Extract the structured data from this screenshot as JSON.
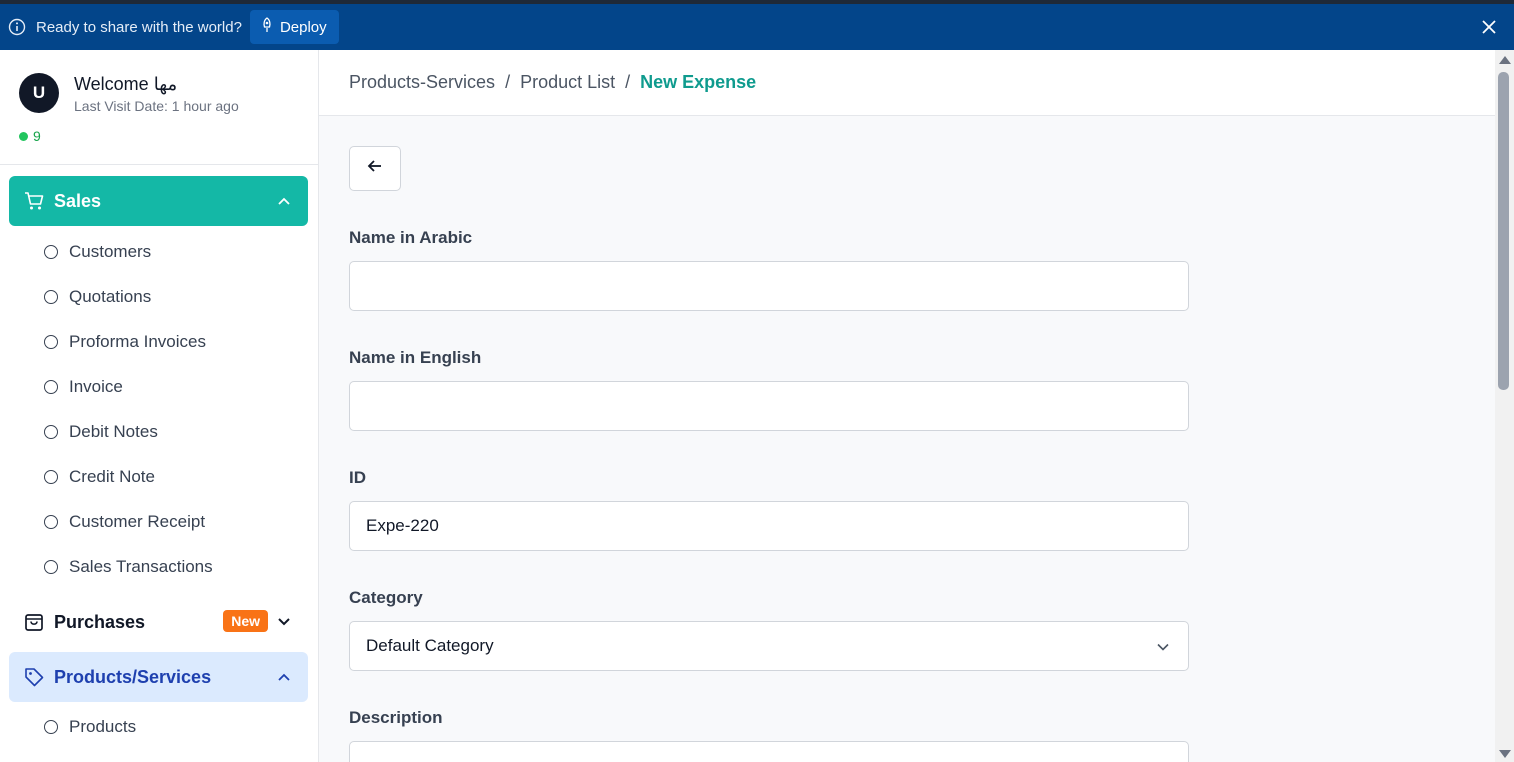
{
  "banner": {
    "message": "Ready to share with the world?",
    "deploy_label": "Deploy"
  },
  "user": {
    "avatar_initial": "U",
    "welcome": "Welcome مها",
    "last_visit": "Last Visit Date: 1 hour ago",
    "online_count": "9"
  },
  "sidebar": {
    "sales_label": "Sales",
    "sales_items": [
      "Customers",
      "Quotations",
      "Proforma Invoices",
      "Invoice",
      "Debit Notes",
      "Credit Note",
      "Customer Receipt",
      "Sales Transactions"
    ],
    "purchases_label": "Purchases",
    "purchases_badge": "New",
    "products_label": "Products/Services",
    "products_items": [
      "Products"
    ]
  },
  "breadcrumb": {
    "items": [
      "Products-Services",
      "Product List"
    ],
    "separator": "/",
    "current": "New Expense"
  },
  "form": {
    "name_ar_label": "Name in Arabic",
    "name_ar_value": "",
    "name_en_label": "Name in English",
    "name_en_value": "",
    "id_label": "ID",
    "id_value": "Expe-220",
    "category_label": "Category",
    "category_value": "Default Category",
    "description_label": "Description"
  },
  "colors": {
    "banner": "#03458a",
    "sales_active": "#14b8a6",
    "products_active": "#dbeafe",
    "badge_new": "#f97316",
    "breadcrumb_current": "#0f9b8e"
  },
  "icons": {
    "banner_info": "info-icon",
    "deploy": "rocket-icon",
    "banner_close": "close-icon",
    "sales": "cart-icon",
    "purchases": "bag-icon",
    "products": "tag-icon",
    "back": "arrow-left-icon"
  }
}
